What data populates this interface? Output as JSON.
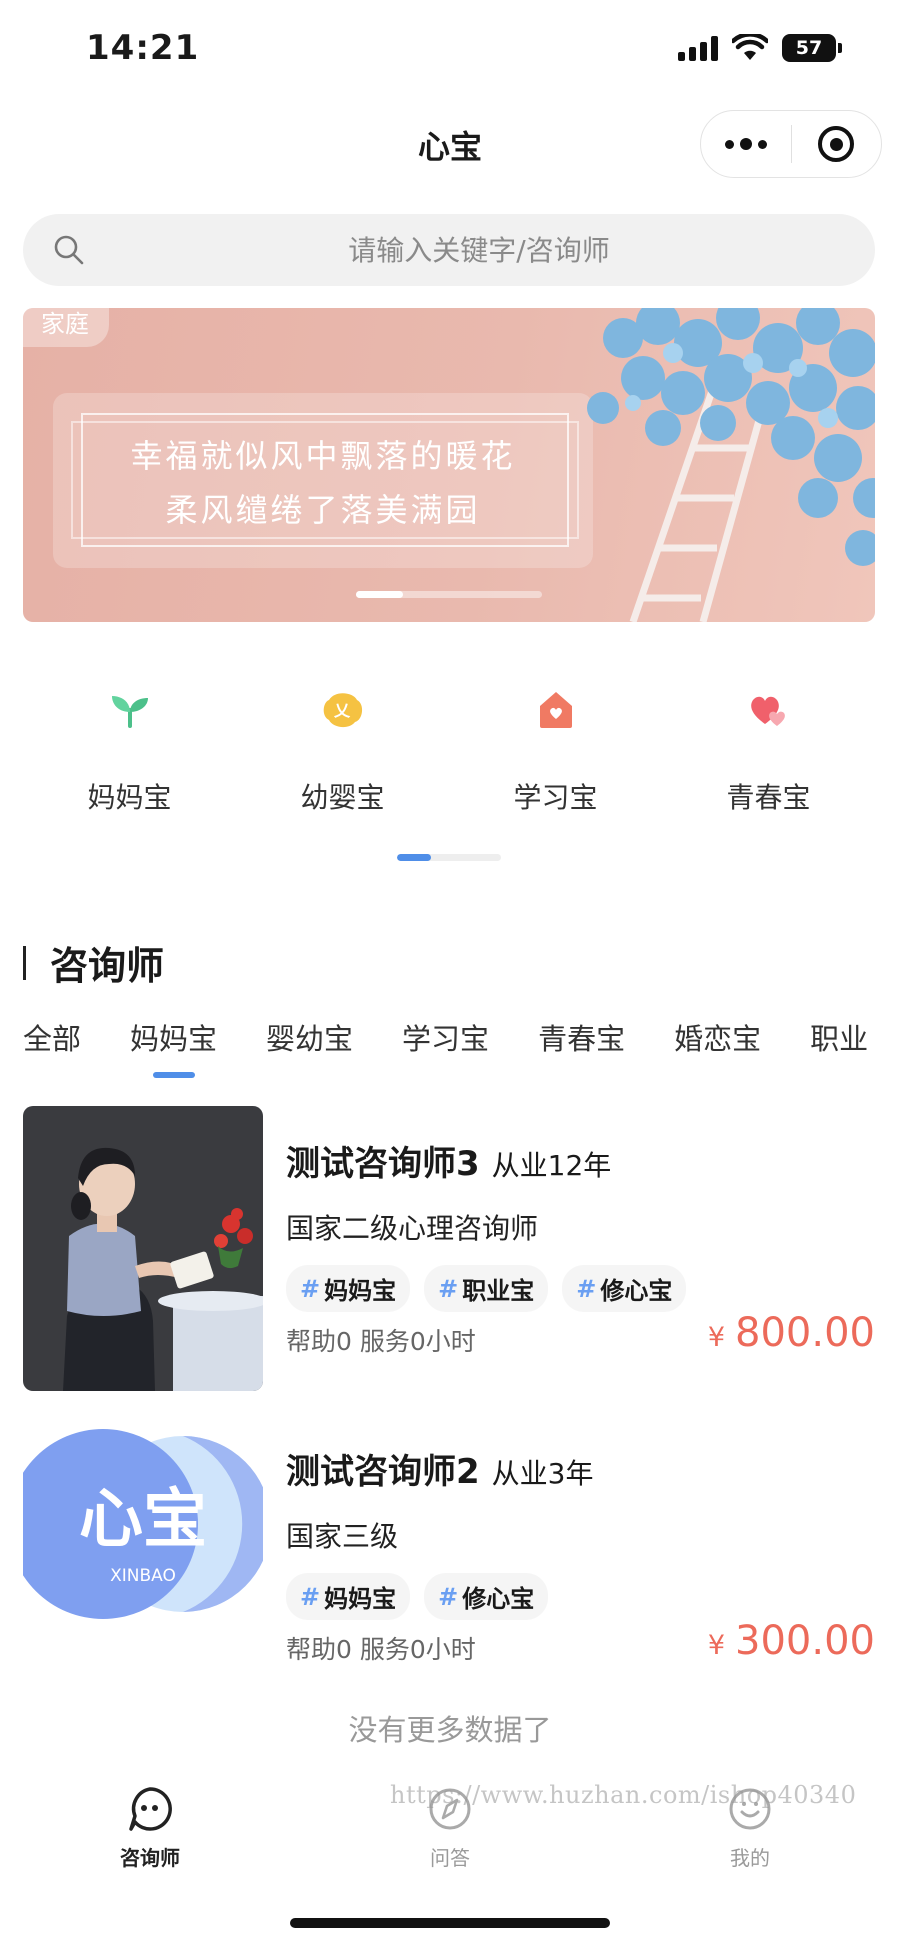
{
  "status_bar": {
    "time": "14:21",
    "battery": "57"
  },
  "nav": {
    "title": "心宝"
  },
  "search": {
    "placeholder": "请输入关键字/咨询师"
  },
  "banner": {
    "tag": "家庭",
    "line1": "幸福就似风中飘落的暖花",
    "line2": "柔风缱绻了落美满园",
    "indicator_progress": 0.25
  },
  "categories": [
    {
      "label": "妈妈宝",
      "icon": "sprout-icon",
      "color": "#5fcf9a"
    },
    {
      "label": "幼婴宝",
      "icon": "baby-icon",
      "color": "#f5c242"
    },
    {
      "label": "学习宝",
      "icon": "house-heart-icon",
      "color": "#f07a63"
    },
    {
      "label": "青春宝",
      "icon": "hearts-icon",
      "color": "#f0606b"
    }
  ],
  "categories_indicator_progress": 0.33,
  "section": {
    "title": "咨询师"
  },
  "filter_tabs": [
    "全部",
    "妈妈宝",
    "婴幼宝",
    "学习宝",
    "青春宝",
    "婚恋宝",
    "职业"
  ],
  "active_filter_index": 1,
  "counselors": [
    {
      "name": "测试咨询师3",
      "years": "从业12年",
      "title": "国家二级心理咨询师",
      "tags": [
        "妈妈宝",
        "职业宝",
        "修心宝"
      ],
      "stats": "帮助0 服务0小时",
      "price_symbol": "¥",
      "price": "800.00"
    },
    {
      "name": "测试咨询师2",
      "years": "从业3年",
      "title": "国家三级",
      "tags": [
        "妈妈宝",
        "修心宝"
      ],
      "stats": "帮助0 服务0小时",
      "price_symbol": "¥",
      "price": "300.00",
      "logo_text": "心宝",
      "logo_sub": "XINBAO"
    }
  ],
  "no_more": "没有更多数据了",
  "tabbar": [
    {
      "label": "咨询师",
      "icon": "face-icon",
      "active": true
    },
    {
      "label": "问答",
      "icon": "compass-icon",
      "active": false
    },
    {
      "label": "我的",
      "icon": "smile-icon",
      "active": false
    }
  ],
  "watermark": "https://www.huzhan.com/ishop40340",
  "colors": {
    "accent": "#4f8ee8",
    "price": "#ec6a5a",
    "tag_hash": "#6a9ff2"
  }
}
